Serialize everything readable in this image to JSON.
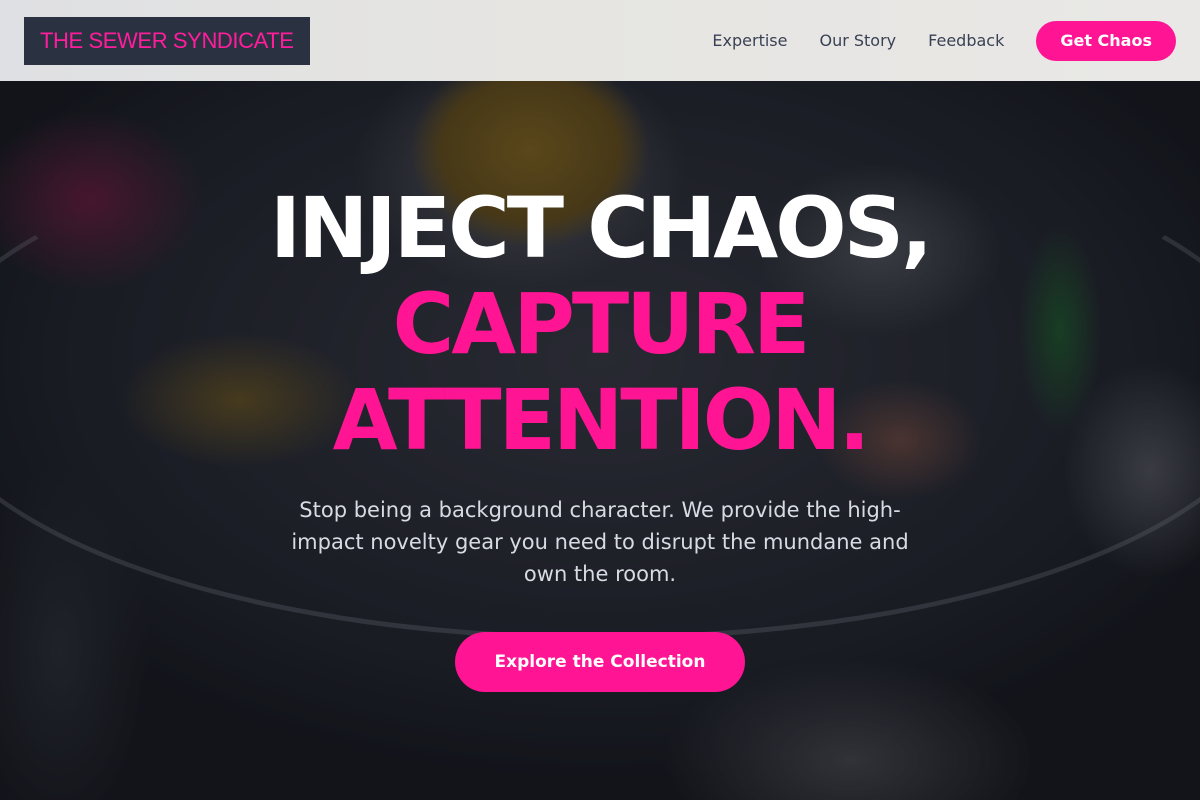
{
  "brand": {
    "logo_text": "THE SEWER SYNDICATE",
    "accent_color": "#ff1493",
    "logo_bg_color": "#2a3242"
  },
  "nav": {
    "links": [
      "Expertise",
      "Our Story",
      "Feedback"
    ],
    "cta_label": "Get Chaos"
  },
  "hero": {
    "headline_line1": "INJECT CHAOS,",
    "headline_line2": "CAPTURE",
    "headline_line3": "ATTENTION.",
    "subtext": "Stop being a background character. We provide the high-impact novelty gear you need to disrupt the mundane and own the room.",
    "cta_label": "Explore the Collection"
  }
}
